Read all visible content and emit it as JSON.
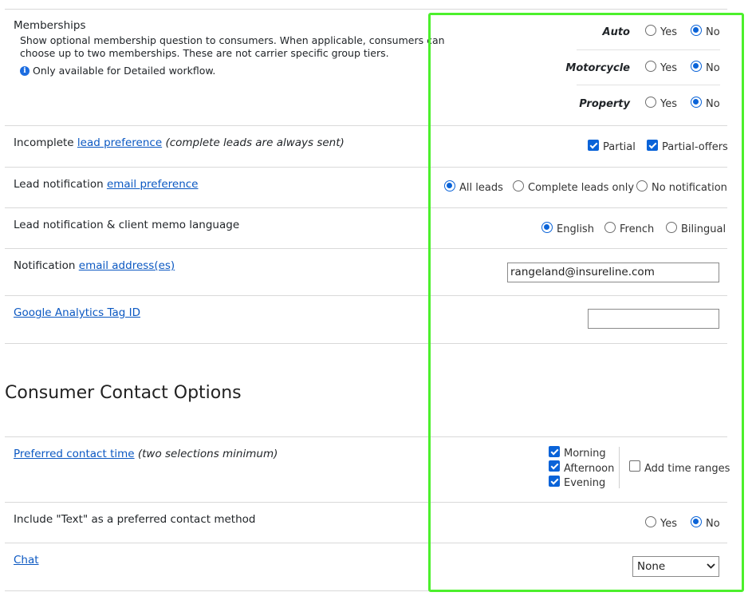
{
  "memberships": {
    "title": "Memberships",
    "description": "Show optional membership question to consumers. When applicable, consumers can choose up to two memberships. These are not carrier specific group tiers.",
    "note": "Only available for Detailed workflow.",
    "rows": [
      {
        "label": "Auto",
        "yes": "Yes",
        "no": "No",
        "selected": "No"
      },
      {
        "label": "Motorcycle",
        "yes": "Yes",
        "no": "No",
        "selected": "No"
      },
      {
        "label": "Property",
        "yes": "Yes",
        "no": "No",
        "selected": "No"
      }
    ]
  },
  "incomplete": {
    "label": "Incomplete",
    "link": "lead preference",
    "note": "(complete leads are always sent)",
    "options": [
      {
        "label": "Partial",
        "checked": true
      },
      {
        "label": "Partial-offers",
        "checked": true
      }
    ]
  },
  "lead_notification": {
    "label": "Lead notification",
    "link": "email preference",
    "options": [
      "All leads",
      "Complete leads only",
      "No notification"
    ],
    "selected": "All leads"
  },
  "language": {
    "label": "Lead notification & client memo language",
    "options": [
      "English",
      "French",
      "Bilingual"
    ],
    "selected": "English"
  },
  "notification_email": {
    "label": "Notification",
    "link": "email address(es)",
    "value": "rangeland@insureline.com"
  },
  "google_analytics": {
    "link": "Google Analytics Tag ID",
    "value": ""
  },
  "consumer_contact": {
    "heading": "Consumer Contact Options"
  },
  "contact_time": {
    "link": "Preferred contact time",
    "note": "(two selections minimum)",
    "options": [
      {
        "label": "Morning",
        "checked": true
      },
      {
        "label": "Afternoon",
        "checked": true
      },
      {
        "label": "Evening",
        "checked": true
      }
    ],
    "add_ranges": {
      "label": "Add time ranges",
      "checked": false
    }
  },
  "text_method": {
    "label": "Include \"Text\" as a preferred contact method",
    "yes": "Yes",
    "no": "No",
    "selected": "No"
  },
  "chat": {
    "link": "Chat",
    "selected": "None"
  },
  "colors": {
    "accent": "#0a63d8",
    "link": "#0b58c2",
    "highlight": "#4cf02c"
  }
}
